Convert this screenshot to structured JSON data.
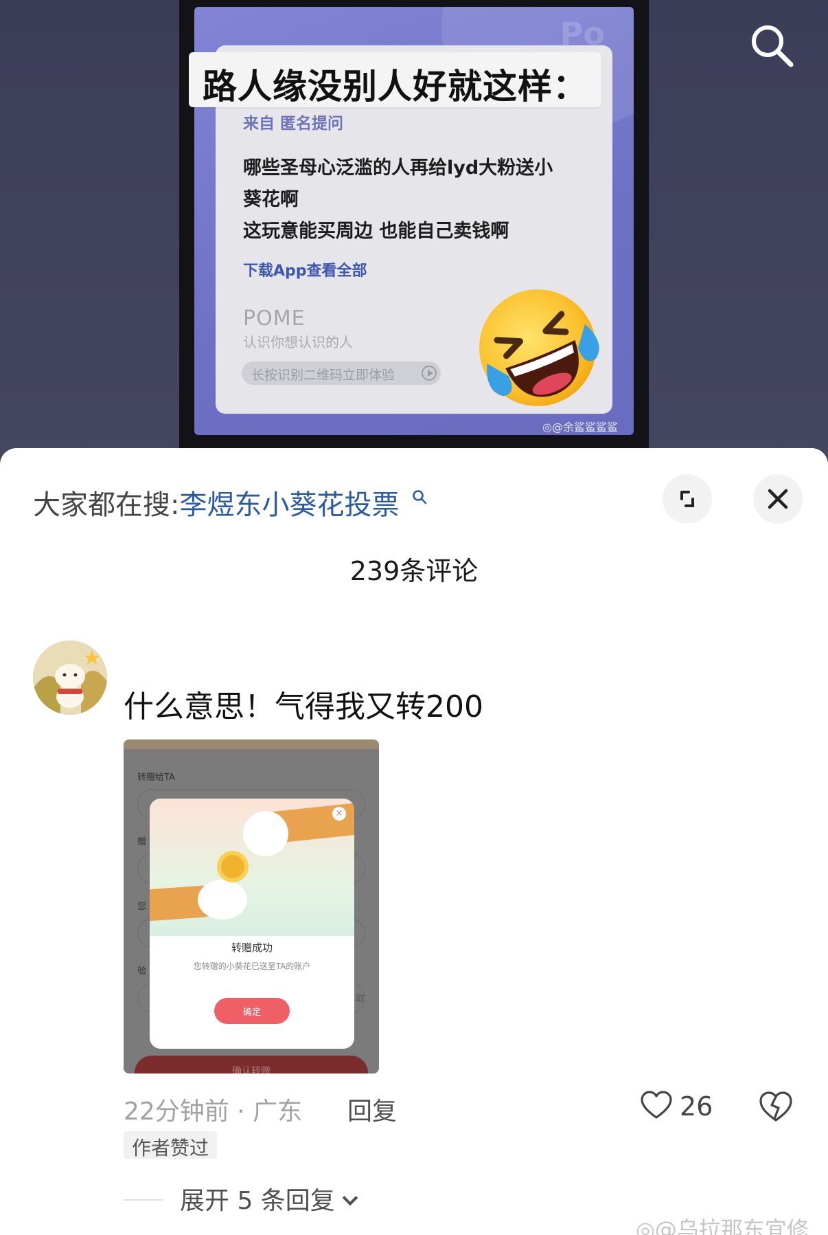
{
  "video": {
    "headline": "路人缘没别人好就这样：",
    "brand_mark": "Po",
    "source_prefix": "来自",
    "source_name": "匿名提问",
    "question_lines": [
      "哪些圣母心泛滥的人再给lyd大粉送小",
      "葵花啊",
      "这玩意能买周边 也能自己卖钱啊"
    ],
    "download_link": "下载App查看全部",
    "app_name": "POME",
    "app_tagline": "认识你想认识的人",
    "qr_hint": "长按识别二维码立即体验",
    "watermark": "@余鲨鲨鲨鲨",
    "emoji": "rolling-on-floor-laughing-emoji"
  },
  "header": {
    "hot_prefix": "大家都在搜:",
    "hot_term": "李煜东小葵花投票",
    "comment_count": "239条评论"
  },
  "comment": {
    "text": "什么意思！气得我又转200",
    "time_location": "22分钟前 · 广东",
    "reply_label": "回复",
    "like_count": "26",
    "author_badge": "作者赞过",
    "expand_label": "展开 5 条回复"
  },
  "screenshot": {
    "labels": [
      "转赠给TA",
      "赠",
      "您",
      "验"
    ],
    "dialog_title": "转赠成功",
    "dialog_body": "您转赠的小葵花已送至TA的账户",
    "dialog_ok": "确定",
    "confirm_button": "确认转赠",
    "side_char": "取"
  },
  "footer": {
    "watermark": "@乌拉那东宜修"
  },
  "colors": {
    "link_blue": "#2c5a9e",
    "card_purple": "#6d70c4",
    "ok_red": "#ef5f66"
  }
}
